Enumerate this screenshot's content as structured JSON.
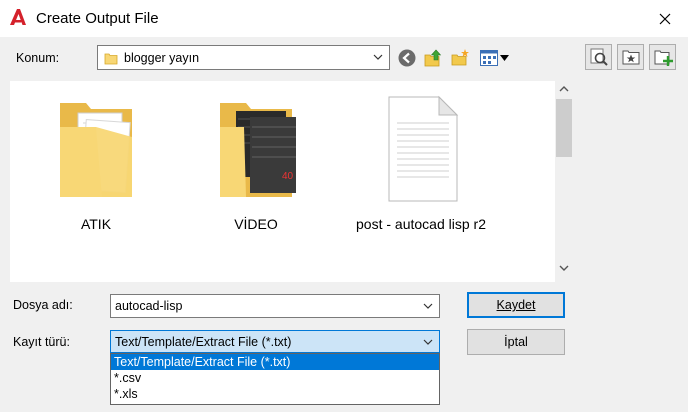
{
  "window": {
    "title": "Create Output File"
  },
  "location": {
    "label": "Konum:",
    "value": "blogger yayın"
  },
  "files": [
    {
      "name": "ATIK",
      "kind": "folder"
    },
    {
      "name": "VİDEO",
      "kind": "folder-media"
    },
    {
      "name": "post - autocad lisp r2",
      "kind": "document"
    }
  ],
  "filename": {
    "label": "Dosya adı:",
    "value": "autocad-lisp"
  },
  "filetype": {
    "label": "Kayıt türü:",
    "value": "Text/Template/Extract File (*.txt)",
    "options": [
      "Text/Template/Extract File (*.txt)",
      "*.csv",
      "*.xls"
    ]
  },
  "buttons": {
    "save": "Kaydet",
    "cancel": "İptal"
  },
  "colors": {
    "accent": "#0078d7",
    "app_red": "#d4212b",
    "folder_yellow": "#f8d775"
  }
}
